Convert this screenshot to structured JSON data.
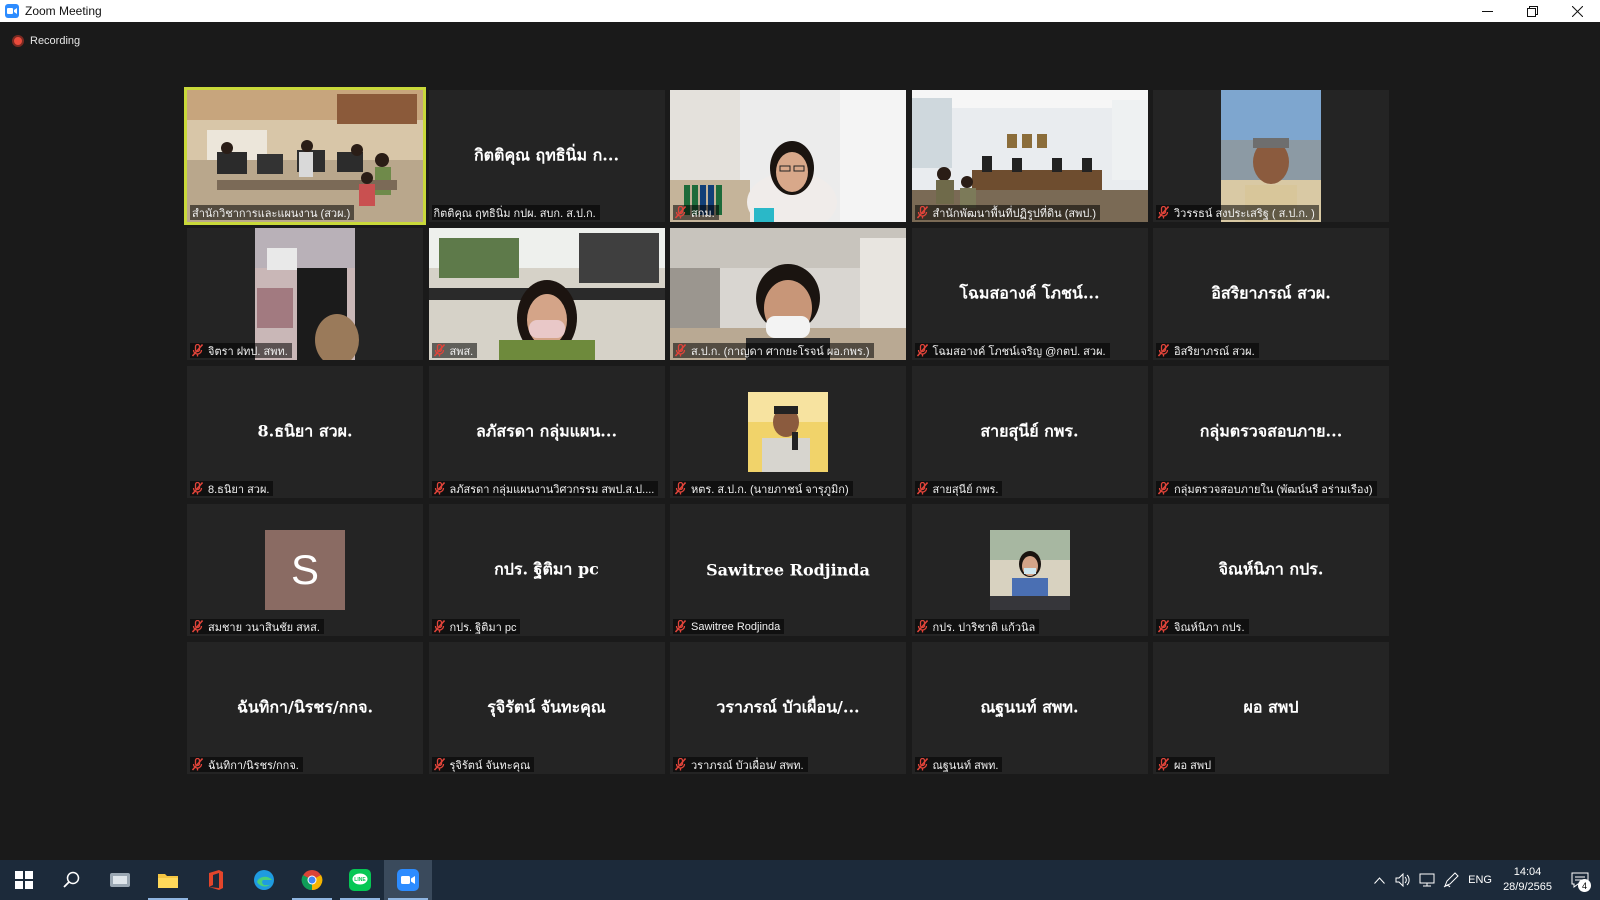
{
  "window": {
    "title": "Zoom Meeting"
  },
  "recording": {
    "label": "Recording"
  },
  "tiles": [
    {
      "row": 0,
      "col": 0,
      "kind": "video",
      "scene": "office-room",
      "active": true,
      "muted": false,
      "label": "สำนักวิชาการและแผนงาน (สวผ.)",
      "center": ""
    },
    {
      "row": 0,
      "col": 1,
      "kind": "name",
      "active": false,
      "muted": false,
      "label": "กิตติคุณ ฤทธินิ่ม กปผ. สบก. ส.ป.ก.",
      "center": "กิตติคุณ ฤทธินิ่ม ก..."
    },
    {
      "row": 0,
      "col": 2,
      "kind": "video",
      "scene": "woman-office",
      "active": false,
      "muted": true,
      "label": "สกม.",
      "center": ""
    },
    {
      "row": 0,
      "col": 3,
      "kind": "video",
      "scene": "meeting-room",
      "active": false,
      "muted": true,
      "label": "สำนักพัฒนาพื้นที่ปฏิรูปที่ดิน (สพป.)",
      "center": ""
    },
    {
      "row": 0,
      "col": 4,
      "kind": "video",
      "scene": "man-uniform",
      "active": false,
      "muted": true,
      "label": "วิวรรธน์ สงประเสริฐ ( ส.ป.ก. )",
      "center": ""
    },
    {
      "row": 1,
      "col": 0,
      "kind": "video",
      "scene": "chair-room",
      "active": false,
      "muted": true,
      "label": "จิตรา ฝทป. สพท.",
      "center": ""
    },
    {
      "row": 1,
      "col": 1,
      "kind": "video",
      "scene": "woman-mask-office",
      "active": false,
      "muted": true,
      "label": "สพส.",
      "center": ""
    },
    {
      "row": 1,
      "col": 2,
      "kind": "video",
      "scene": "woman-mask-virtual",
      "active": false,
      "muted": true,
      "label": "ส.ป.ก. (กาญดา ศากยะโรจน์ ผอ.กพร.)",
      "center": ""
    },
    {
      "row": 1,
      "col": 3,
      "kind": "name",
      "active": false,
      "muted": true,
      "label": "โฉมสอางค์ โภชน์เจริญ @กตป. สวผ.",
      "center": "โฉมสอางค์ โภชน์..."
    },
    {
      "row": 1,
      "col": 4,
      "kind": "name",
      "active": false,
      "muted": true,
      "label": "อิสริยาภรณ์ สวผ.",
      "center": "อิสริยาภรณ์ สวผ."
    },
    {
      "row": 2,
      "col": 0,
      "kind": "name",
      "active": false,
      "muted": true,
      "label": "8.ธนิยา สวผ.",
      "center": "8.ธนิยา สวผ."
    },
    {
      "row": 2,
      "col": 1,
      "kind": "name",
      "active": false,
      "muted": true,
      "label": "ลภัสรดา  กลุ่มแผนงานวิศวกรรม สพป.ส.ป....",
      "center": "ลภัสรดา  กลุ่มแผน..."
    },
    {
      "row": 2,
      "col": 2,
      "kind": "thumb",
      "scene": "man-mic",
      "active": false,
      "muted": true,
      "label": "หตร. ส.ป.ก. (นายภาชน์  จารุภูมิก)",
      "center": ""
    },
    {
      "row": 2,
      "col": 3,
      "kind": "name",
      "active": false,
      "muted": true,
      "label": "สายสุนีย์  กพร.",
      "center": "สายสุนีย์  กพร."
    },
    {
      "row": 2,
      "col": 4,
      "kind": "name",
      "active": false,
      "muted": true,
      "label": "กลุ่มตรวจสอบภายใน (พัฒน์นรี อร่ามเรือง)",
      "center": "กลุ่มตรวจสอบภาย..."
    },
    {
      "row": 3,
      "col": 0,
      "kind": "avatar",
      "avatar_letter": "S",
      "active": false,
      "muted": true,
      "label": "สมชาย วนาสินชัย สหส.",
      "center": ""
    },
    {
      "row": 3,
      "col": 1,
      "kind": "name",
      "active": false,
      "muted": true,
      "label": "กปร. ฐิติมา pc",
      "center": "กปร. ฐิติมา pc"
    },
    {
      "row": 3,
      "col": 2,
      "kind": "name",
      "active": false,
      "muted": true,
      "label": "Sawitree Rodjinda",
      "center": "Sawitree Rodjinda"
    },
    {
      "row": 3,
      "col": 3,
      "kind": "thumb",
      "scene": "woman-desk",
      "active": false,
      "muted": true,
      "label": "กปร. ปาริชาติ แก้วนิล",
      "center": ""
    },
    {
      "row": 3,
      "col": 4,
      "kind": "name",
      "active": false,
      "muted": true,
      "label": "จิณห์นิภา กปร.",
      "center": "จิณห์นิภา กปร."
    },
    {
      "row": 4,
      "col": 0,
      "kind": "name",
      "active": false,
      "muted": true,
      "label": "ฉันทิกา/นิรชร/กกจ.",
      "center": "ฉันทิกา/นิรชร/กกจ."
    },
    {
      "row": 4,
      "col": 1,
      "kind": "name",
      "active": false,
      "muted": true,
      "label": "รุจิรัตน์ จันทะคุณ",
      "center": "รุจิรัตน์ จันทะคุณ"
    },
    {
      "row": 4,
      "col": 2,
      "kind": "name",
      "active": false,
      "muted": true,
      "label": "วราภรณ์ บัวเผื่อน/ สพท.",
      "center": "วราภรณ์ บัวเผื่อน/..."
    },
    {
      "row": 4,
      "col": 3,
      "kind": "name",
      "active": false,
      "muted": true,
      "label": "ณฐนนท์ สพท.",
      "center": "ณฐนนท์ สพท."
    },
    {
      "row": 4,
      "col": 4,
      "kind": "name",
      "active": false,
      "muted": true,
      "label": "ผอ สพป",
      "center": "ผอ สพป"
    }
  ],
  "taskbar": {
    "items": [
      "start-icon",
      "search-icon",
      "app-icon",
      "file-explorer-icon",
      "office-icon",
      "edge-icon",
      "chrome-icon",
      "line-icon",
      "zoom-icon"
    ],
    "active": "zoom-icon",
    "language": "ENG",
    "time": "14:04",
    "date": "28/9/2565",
    "notification_count": "4"
  },
  "colors": {
    "active_speaker": "#c9d93a",
    "mute_red": "#e0443a",
    "zoom_blue": "#2d8cff"
  }
}
